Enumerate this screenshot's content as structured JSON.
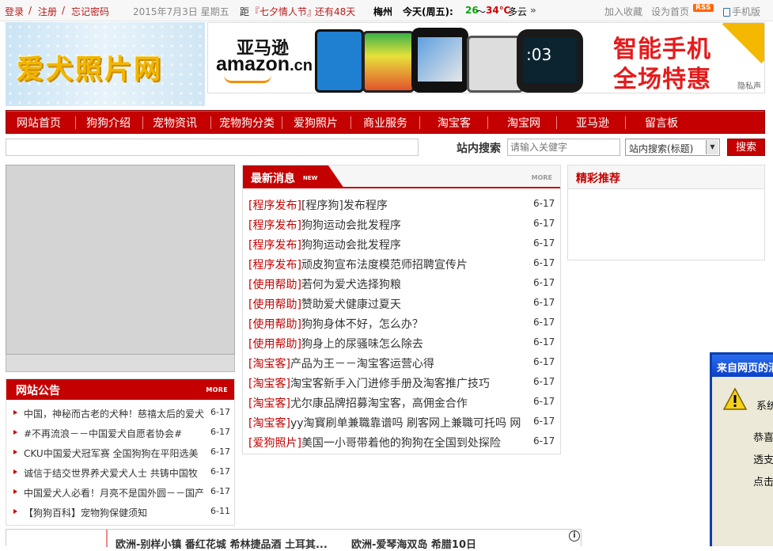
{
  "topbar": {
    "login": "登录",
    "register": "注册",
    "forgot": "忘记密码",
    "date": "2015年7月3日 星期五",
    "countdown_prefix": "距",
    "countdown_event": "『七夕情人节』",
    "countdown_suffix": "还有48天",
    "city": "梅州",
    "weather_label": "今天(周五):",
    "temp_low": "26",
    "temp_sep": "～",
    "temp_high": "34℃",
    "condition": "多云",
    "more_arrow": "»",
    "favorite": "加入收藏",
    "homepage": "设为首页",
    "rss": "RSS",
    "mobile": "手机版"
  },
  "header": {
    "logo_text": "爱犬照片网",
    "banner": {
      "amazon_cn": "亚马逊",
      "amazon": "amazon",
      "amazon_tld": ".cn",
      "phone_time": ":03",
      "promo_line1": "智能手机",
      "promo_line2": "全场特惠",
      "privacy": "隐私声"
    }
  },
  "nav": {
    "items": [
      "网站首页",
      "狗狗介绍",
      "宠物资讯",
      "宠物狗分类",
      "爱狗照片",
      "商业服务",
      "淘宝客",
      "淘宝网",
      "亚马逊",
      "留言板"
    ]
  },
  "search": {
    "label": "站内搜索",
    "placeholder": "请输入关健字",
    "scope": "站内搜索(标题)",
    "button": "搜索"
  },
  "notice": {
    "title": "网站公告",
    "more": "MORE",
    "items": [
      {
        "text": "中国，神秘而古老的犬种！慈禧太后的爱犬",
        "date": "6-17"
      },
      {
        "text": "#不再流浪－－中国爱犬自愿者协会#",
        "date": "6-17"
      },
      {
        "text": "CKU中国爱犬冠军赛 全国狗狗在平阳选美",
        "date": "6-17"
      },
      {
        "text": "诚信于结交世界养犬爱犬人士 共铸中国牧",
        "date": "6-17"
      },
      {
        "text": "中国爱犬人必看！月亮不是国外圆－－国产",
        "date": "6-17"
      },
      {
        "text": "【狗狗百科】宠物狗保健须知",
        "date": "6-11"
      }
    ]
  },
  "news": {
    "title": "最新消息",
    "new_tag": "NEW",
    "more": "MORE",
    "items": [
      {
        "cat": "[程序发布]",
        "text": "[程序狗]发布程序",
        "date": "6-17"
      },
      {
        "cat": "[程序发布]",
        "text": "狗狗运动会批发程序",
        "date": "6-17"
      },
      {
        "cat": "[程序发布]",
        "text": "狗狗运动会批发程序",
        "date": "6-17"
      },
      {
        "cat": "[程序发布]",
        "text": "顽皮狗宣布法度模范师招聘宣传片",
        "date": "6-17"
      },
      {
        "cat": "[使用帮助]",
        "text": "若何为爱犬选择狗粮",
        "date": "6-17"
      },
      {
        "cat": "[使用帮助]",
        "text": "赞助爱犬健康过夏天",
        "date": "6-17"
      },
      {
        "cat": "[使用帮助]",
        "text": "狗狗身体不好，怎么办？",
        "date": "6-17"
      },
      {
        "cat": "[使用帮助]",
        "text": "狗身上的尿骚味怎么除去",
        "date": "6-17"
      },
      {
        "cat": "[淘宝客]",
        "text": "产品为王－－淘宝客运营心得",
        "date": "6-17"
      },
      {
        "cat": "[淘宝客]",
        "text": "淘宝客新手入门进修手册及淘客推广技巧",
        "date": "6-17"
      },
      {
        "cat": "[淘宝客]",
        "text": "尤尔康品牌招募淘宝客，高佣金合作",
        "date": "6-17"
      },
      {
        "cat": "[淘宝客]",
        "text": "yy淘寳刷单兼職靠谱吗 刷客网上兼職可托吗 网",
        "date": "6-17"
      },
      {
        "cat": "[爱狗照片]",
        "text": "美国一小哥带着他的狗狗在全国到处探险",
        "date": "6-17"
      }
    ]
  },
  "recommend": {
    "title": "精彩推荐"
  },
  "bottom": {
    "item1": "欧洲-别样小镇 番红花城 希林捷品酒 土耳其...",
    "item2": "欧洲-爱琴海双岛 希腊10日",
    "info": "i"
  },
  "dialog": {
    "title": "来自网页的消息",
    "line1": "系统",
    "line2": "恭喜",
    "line3": "透支",
    "line4": "点击"
  }
}
